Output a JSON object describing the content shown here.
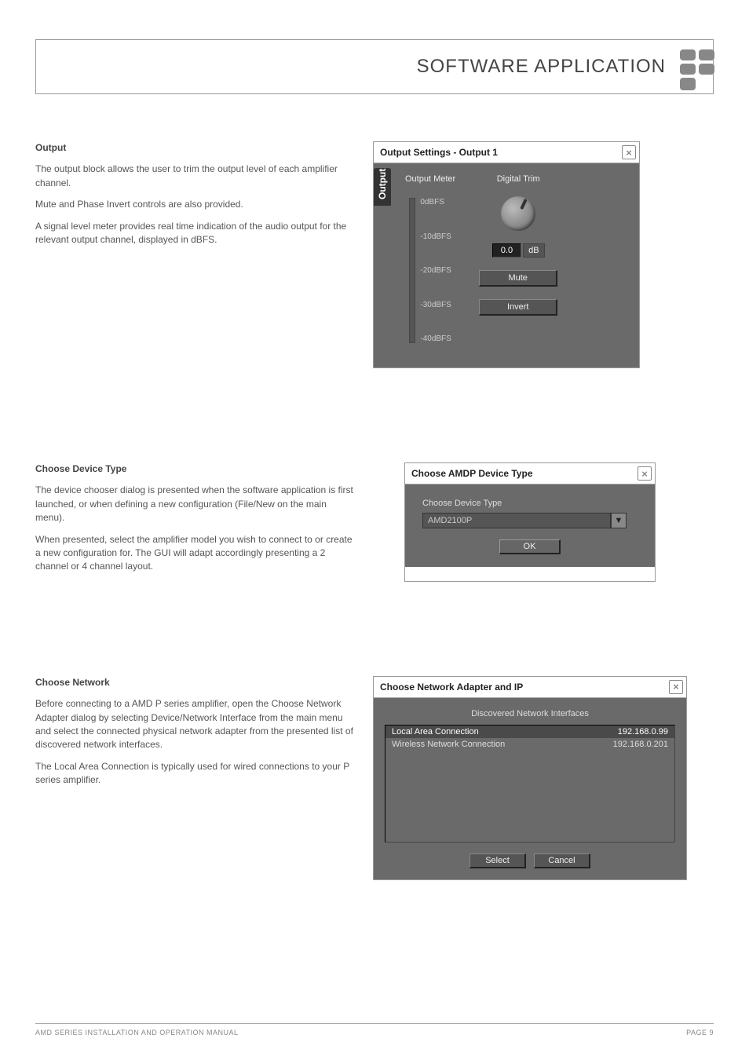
{
  "header": {
    "title": "SOFTWARE APPLICATION"
  },
  "sections": {
    "output": {
      "heading": "Output",
      "p1": "The output block allows the user to trim the output level of each amplifier channel.",
      "p2": "Mute and Phase Invert controls are also provided.",
      "p3": "A signal level meter provides real time indication of the audio output for the relevant output channel, displayed in dBFS."
    },
    "device": {
      "heading": "Choose Device Type",
      "p1": "The device chooser dialog is presented when the software application is first launched, or when defining a new configuration (File/New on the main menu).",
      "p2": "When presented, select the amplifier model you wish to connect to or create a new configuration for. The GUI will adapt accordingly presenting a 2 channel or 4 channel layout."
    },
    "network": {
      "heading": "Choose Network",
      "p1": "Before connecting to a AMD P series amplifier, open the Choose Network Adapter dialog by selecting Device/Network Interface from the main menu and select the connected physical network adapter from the presented list of discovered network interfaces.",
      "p2": "The Local Area Connection is typically used for wired connections to your P series amplifier."
    }
  },
  "output_dialog": {
    "title": "Output Settings - Output 1",
    "tab": "Output",
    "meter_label": "Output Meter",
    "trim_label": "Digital Trim",
    "ticks": [
      "0dBFS",
      "-10dBFS",
      "-20dBFS",
      "-30dBFS",
      "-40dBFS"
    ],
    "trim_value": "0.0",
    "trim_unit": "dB",
    "mute": "Mute",
    "invert": "Invert"
  },
  "device_dialog": {
    "title": "Choose AMDP Device Type",
    "group_label": "Choose Device Type",
    "selected": "AMD2100P",
    "ok": "OK"
  },
  "network_dialog": {
    "title": "Choose Network Adapter and IP",
    "group_label": "Discovered Network Interfaces",
    "rows": [
      {
        "name": "Local Area Connection",
        "ip": "192.168.0.99"
      },
      {
        "name": "Wireless Network Connection",
        "ip": "192.168.0.201"
      }
    ],
    "select": "Select",
    "cancel": "Cancel"
  },
  "footer": {
    "left": "AMD SERIES INSTALLATION AND OPERATION MANUAL",
    "right": "PAGE 9"
  }
}
